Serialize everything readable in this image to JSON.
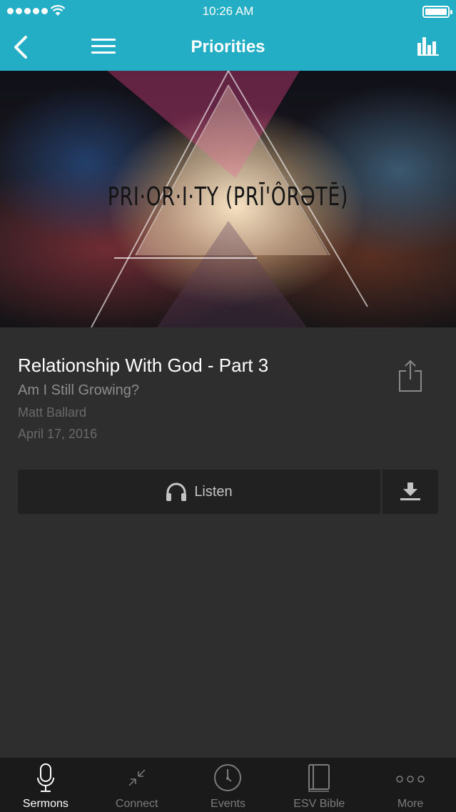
{
  "status_bar": {
    "time": "10:26 AM"
  },
  "nav": {
    "title": "Priorities"
  },
  "hero": {
    "artwork_text": "PRI·OR·I·TY (PRĪ'ÔRƏTĒ)"
  },
  "sermon": {
    "title": "Relationship With God - Part 3",
    "subtitle": "Am I Still Growing?",
    "speaker": "Matt Ballard",
    "date": "April 17, 2016"
  },
  "player": {
    "listen_label": "Listen"
  },
  "tabs": [
    {
      "label": "Sermons",
      "icon": "microphone-icon",
      "active": true
    },
    {
      "label": "Connect",
      "icon": "connect-arrows-icon",
      "active": false
    },
    {
      "label": "Events",
      "icon": "clock-icon",
      "active": false
    },
    {
      "label": "ESV Bible",
      "icon": "book-icon",
      "active": false
    },
    {
      "label": "More",
      "icon": "more-dots-icon",
      "active": false
    }
  ],
  "colors": {
    "accent": "#24aec5",
    "background": "#2f2e2f",
    "tabbar": "#1b1a1b"
  }
}
